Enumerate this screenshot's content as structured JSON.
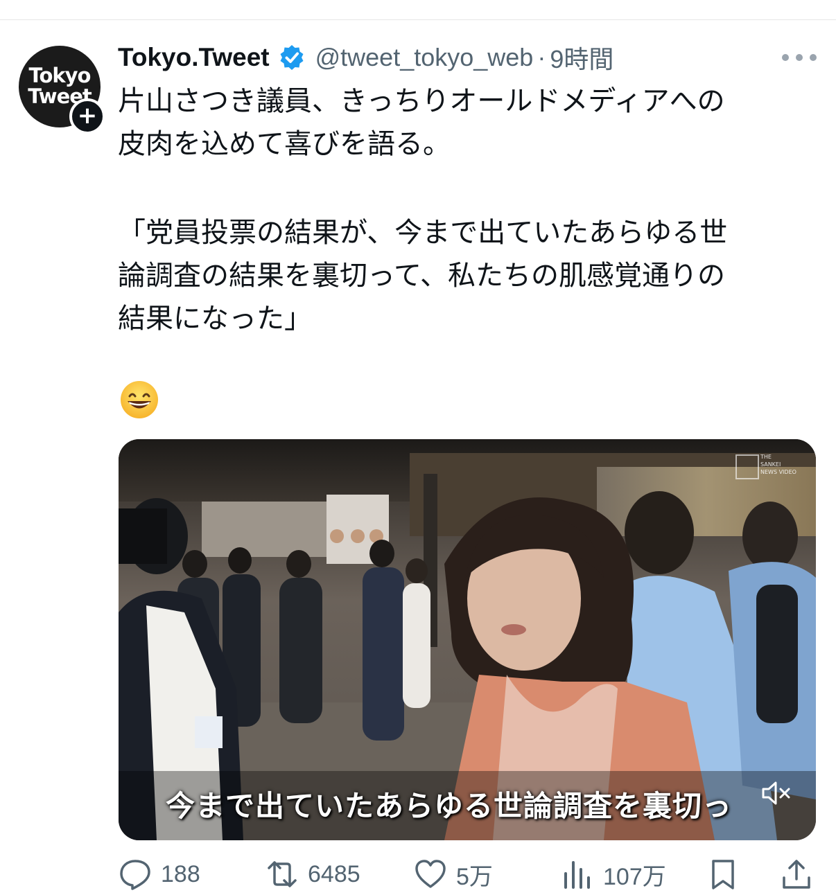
{
  "tweet": {
    "author_name": "Tokyo.Tweet",
    "handle": "@tweet_tokyo_web",
    "separator": "·",
    "time": "9時間",
    "avatar_line1": "Tokyo",
    "avatar_line2": "Tweet",
    "follow_symbol": "+",
    "verified_icon": "verified-badge-icon",
    "text_line1": "片山さつき議員、きっちりオールドメディアへの",
    "text_line2": "皮肉を込めて喜びを語る。",
    "quote_line1": "「党員投票の結果が、今まで出ていたあらゆる世",
    "quote_line2": "論調査の結果を裏切って、私たちの肌感覚通りの",
    "quote_line3": "結果になった」",
    "emoji": "grinning-face-emoji"
  },
  "media": {
    "caption": "今まで出ていたあらゆる世論調査を裏切っ",
    "watermark_lines": [
      "THE",
      "SANKEI",
      "NEWS VIDEO"
    ],
    "muted": true
  },
  "actions": {
    "replies": "188",
    "reposts": "6485",
    "likes": "5万",
    "views": "107万"
  },
  "colors": {
    "text": "#0f1419",
    "secondary": "#536471",
    "verified": "#1d9bf0"
  }
}
